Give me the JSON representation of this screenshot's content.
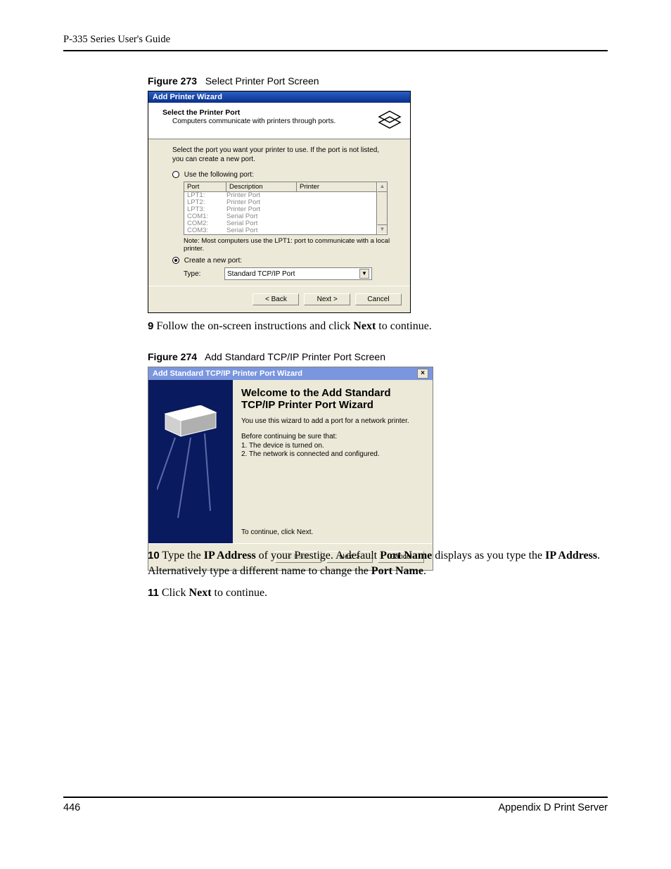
{
  "header": {
    "title": "P-335 Series User's Guide"
  },
  "fig273": {
    "label": "Figure 273",
    "title": "Select Printer Port Screen",
    "window_title": "Add Printer Wizard",
    "hb_title": "Select the Printer Port",
    "hb_sub": "Computers communicate with printers through ports.",
    "instr": "Select the port you want your printer to use.  If the port is not listed, you can create a new port.",
    "radio_use": "Use the following port:",
    "radio_create": "Create a new port:",
    "col_port": "Port",
    "col_desc": "Description",
    "col_printer": "Printer",
    "rows": [
      {
        "port": "LPT1:",
        "desc": "Printer Port"
      },
      {
        "port": "LPT2:",
        "desc": "Printer Port"
      },
      {
        "port": "LPT3:",
        "desc": "Printer Port"
      },
      {
        "port": "COM1:",
        "desc": "Serial Port"
      },
      {
        "port": "COM2:",
        "desc": "Serial Port"
      },
      {
        "port": "COM3:",
        "desc": "Serial Port"
      }
    ],
    "note": "Note: Most computers use the LPT1: port to communicate with a local printer.",
    "type_label": "Type:",
    "type_value": "Standard TCP/IP Port",
    "btn_back": "< Back",
    "btn_next": "Next >",
    "btn_cancel": "Cancel"
  },
  "step9": {
    "num": "9",
    "text_before": "Follow the on-screen instructions and click ",
    "bold": "Next",
    "text_after": " to continue."
  },
  "fig274": {
    "label": "Figure 274",
    "title": "Add Standard TCP/IP Printer Port Screen",
    "window_title": "Add Standard TCP/IP Printer Port Wizard",
    "h1_line1": "Welcome to the Add Standard",
    "h1_line2": "TCP/IP Printer Port Wizard",
    "p1": "You use this wizard to add a port for a network printer.",
    "p2_intro": "Before continuing be sure that:",
    "p2_item1": "1.  The device is turned on.",
    "p2_item2": "2.  The network is connected and configured.",
    "cont": "To continue, click Next.",
    "btn_back": "< Back",
    "btn_next": "Next >",
    "btn_cancel": "Cancel"
  },
  "step10": {
    "num": "10",
    "seg1": "Type the ",
    "b1": "IP Address",
    "seg2": " of your Prestige. A default ",
    "b2": "Port Name",
    "seg3": " displays as you type the ",
    "b3": "IP Address",
    "seg4": ". Alternatively type a different name to change the ",
    "b4": "Port Name",
    "seg5": "."
  },
  "step11": {
    "num": "11",
    "seg1": "Click ",
    "b1": "Next",
    "seg2": " to continue."
  },
  "footer": {
    "page": "446",
    "section": "Appendix D Print Server"
  }
}
